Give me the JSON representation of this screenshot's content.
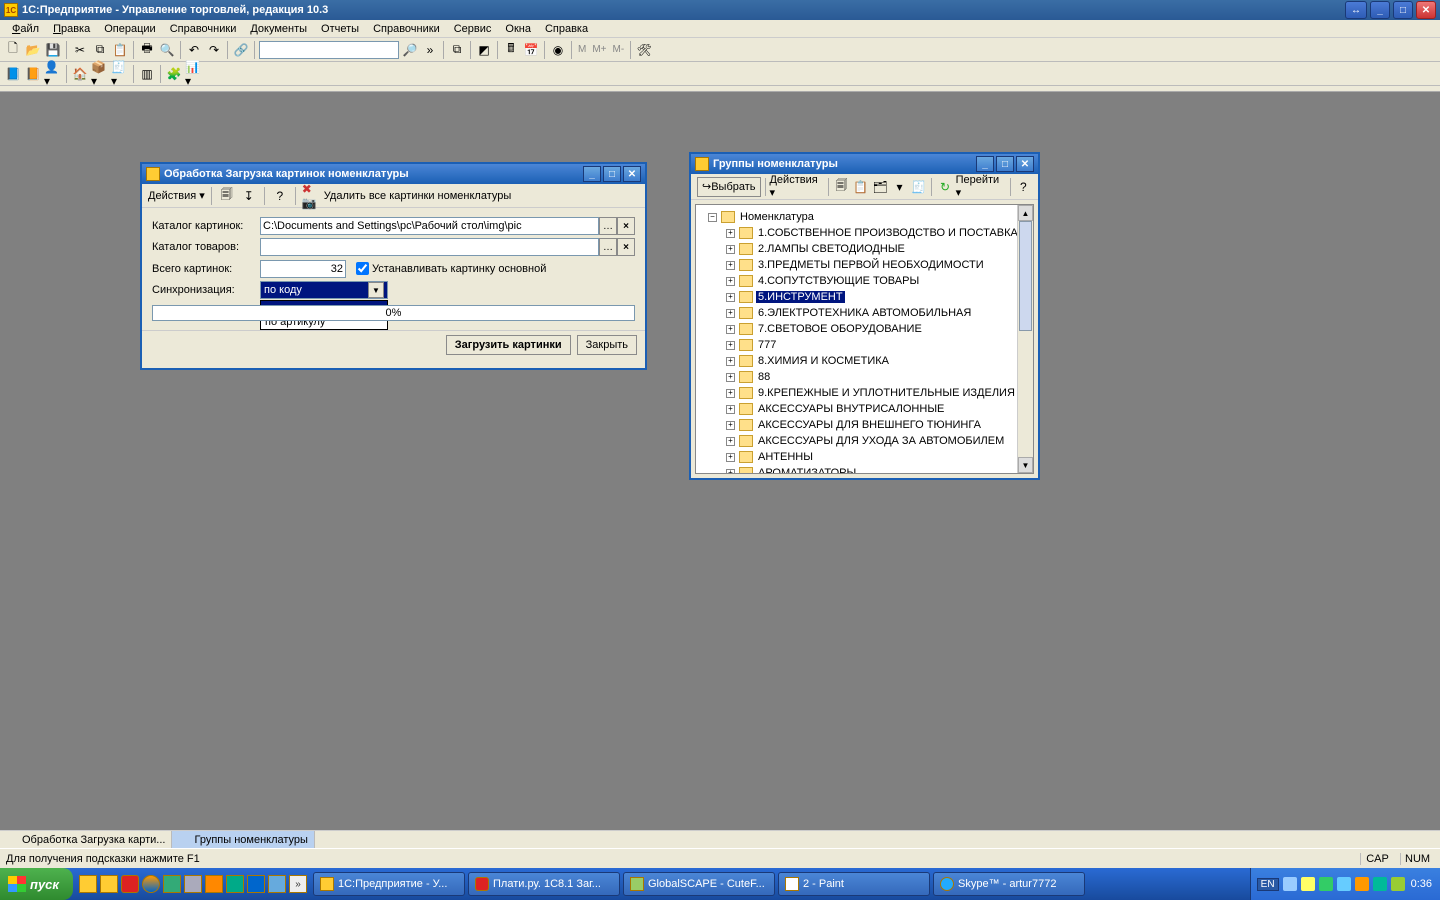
{
  "title": "1С:Предприятие - Управление торговлей, редакция 10.3",
  "menus": [
    "Файл",
    "Правка",
    "Операции",
    "Справочники",
    "Документы",
    "Отчеты",
    "Справочники",
    "Сервис",
    "Окна",
    "Справка"
  ],
  "dlg1": {
    "title": "Обработка  Загрузка картинок номенклатуры",
    "actions": "Действия",
    "delete_all": "Удалить все картинки номенклатуры",
    "label_catalog_img": "Каталог картинок:",
    "value_catalog_img": "C:\\Documents and Settings\\pc\\Рабочий стол\\img\\pic",
    "label_catalog_goods": "Каталог товаров:",
    "value_catalog_goods": "",
    "label_total": "Всего картинок:",
    "value_total": "32",
    "checkbox": "Устанавливать картинку основной",
    "label_sync": "Синхронизация:",
    "combo_value": "по коду",
    "combo_options": [
      "по коду",
      "по артикулу"
    ],
    "progress": "0%",
    "btn_load": "Загрузить картинки",
    "btn_close": "Закрыть"
  },
  "dlg2": {
    "title": "Группы номенклатуры",
    "btn_select": "Выбрать",
    "btn_actions": "Действия",
    "btn_goto": "Перейти",
    "root": "Номенклатура",
    "items": [
      "1.СОБСТВЕННОЕ ПРОИЗВОДСТВО И ПОСТАВКА",
      "2.ЛАМПЫ  СВЕТОДИОДНЫЕ",
      "3.ПРЕДМЕТЫ ПЕРВОЙ НЕОБХОДИМОСТИ",
      "4.СОПУТСТВУЮЩИЕ ТОВАРЫ",
      "5.ИНСТРУМЕНТ",
      "6.ЭЛЕКТРОТЕХНИКА АВТОМОБИЛЬНАЯ",
      "7.СВЕТОВОЕ ОБОРУДОВАНИЕ",
      "777",
      "8.ХИМИЯ И КОСМЕТИКА",
      "88",
      "9.КРЕПЕЖНЫЕ И УПЛОТНИТЕЛЬНЫЕ ИЗДЕЛИЯ",
      "АКСЕССУАРЫ ВНУТРИСАЛОННЫЕ",
      "АКСЕССУАРЫ ДЛЯ ВНЕШНЕГО ТЮНИНГА",
      "АКСЕССУАРЫ ДЛЯ УХОДА ЗА АВТОМОБИЛЕМ",
      "АНТЕННЫ",
      "АРОМАТИЗАТОРЫ"
    ],
    "selected_index": 4
  },
  "mdi_tabs": [
    "Обработка  Загрузка карти...",
    "Группы номенклатуры"
  ],
  "status_hint": "Для получения подсказки нажмите F1",
  "status_cap": "CAP",
  "status_num": "NUM",
  "taskbar": {
    "start": "пуск",
    "tasks": [
      "1С:Предприятие - У...",
      "Плати.ру. 1С8.1 Заг...",
      "GlobalSCAPE - CuteF...",
      "2 - Paint",
      "Skype™ - artur7772"
    ],
    "lang": "EN",
    "clock": "0:36"
  }
}
